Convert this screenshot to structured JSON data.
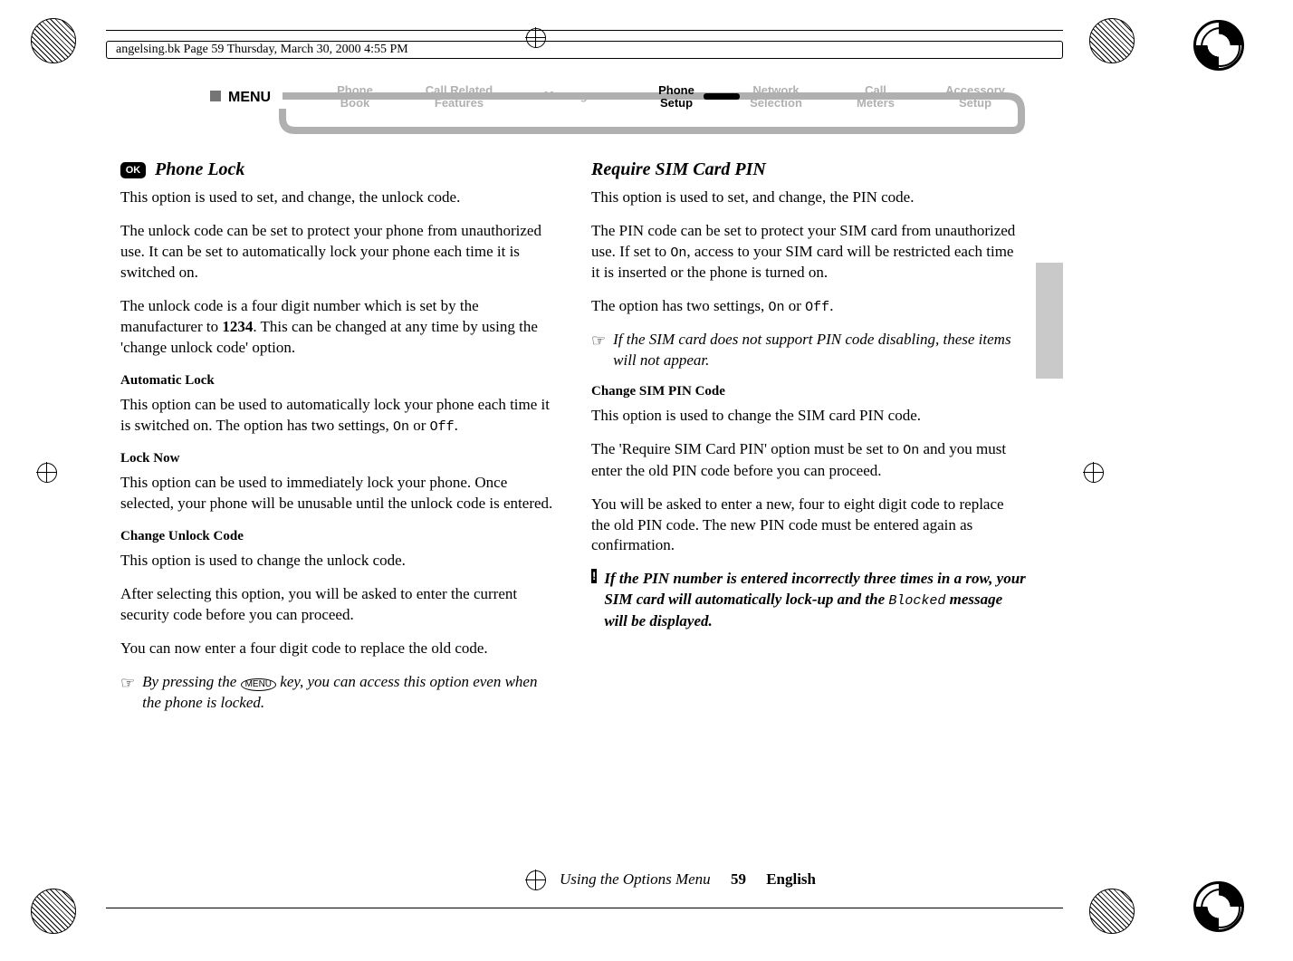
{
  "print_header": "angelsing.bk  Page 59  Thursday, March 30, 2000  4:55 PM",
  "ok_badge": "OK",
  "nav": {
    "menu_label": "MENU",
    "items": [
      {
        "l1": "Phone",
        "l2": "Book",
        "active": false
      },
      {
        "l1": "Call Related",
        "l2": "Features",
        "active": false
      },
      {
        "l1": "Messages",
        "l2": "",
        "active": false
      },
      {
        "l1": "Phone",
        "l2": "Setup",
        "active": true
      },
      {
        "l1": "Network",
        "l2": "Selection",
        "active": false
      },
      {
        "l1": "Call",
        "l2": "Meters",
        "active": false
      },
      {
        "l1": "Accessory",
        "l2": "Setup",
        "active": false
      }
    ]
  },
  "left": {
    "title": "Phone Lock",
    "p1": "This option is used to set, and change, the unlock code.",
    "p2": "The unlock code can be set to protect your phone from unauthorized use. It can be set to automatically lock your phone each time it is switched on.",
    "p3a": "The unlock code is a four digit number which is set by the manufacturer to ",
    "p3code": "1234",
    "p3b": ". This can be changed at any time by using the 'change unlock code' option.",
    "h_auto": "Automatic Lock",
    "p_auto_a": "This option can be used to automatically lock your phone each time it is switched on. The option has two settings, ",
    "mono_on": "On",
    "p_auto_b": " or ",
    "mono_off": "Off",
    "p_auto_c": ".",
    "h_locknow": "Lock Now",
    "p_locknow": "This option can be used to immediately lock your phone. Once selected, your phone will be unusable until the unlock code is entered.",
    "h_change": "Change Unlock Code",
    "p_change1": "This option is used to change the unlock code.",
    "p_change2": "After selecting this option, you will be asked to enter the current security code before you can proceed.",
    "p_change3": "You can now enter a four digit code to replace the old code.",
    "note_a": "By pressing the ",
    "note_key": "MENU",
    "note_b": " key, you can access this option even when the phone is locked."
  },
  "right": {
    "title": "Require SIM Card PIN",
    "p1": "This option is used to set, and change, the PIN code.",
    "p2a": "The PIN code can be set to protect your SIM card from unauthorized use. If set to ",
    "mono_on": "On",
    "p2b": ", access to your SIM card will be restricted each time it is inserted or the phone is turned on.",
    "p3a": "The option has two settings, ",
    "p3b": " or ",
    "mono_off": "Off",
    "p3c": ".",
    "note": "If the SIM card does not support PIN code disabling, these items will not appear.",
    "h_change": "Change SIM PIN Code",
    "p_c1": "This option is used to change the SIM card PIN code.",
    "p_c2a": "The 'Require SIM Card PIN' option must be set to ",
    "p_c2b": " and you must enter the old PIN code before you can proceed.",
    "p_c3": "You will be asked to enter a new, four to eight digit code to replace the old PIN code. The new PIN code must be entered again as confirmation.",
    "warn_a": "If the PIN number is entered incorrectly three times in a row, your SIM card will automatically lock-up and the ",
    "warn_mono": "Blocked",
    "warn_b": " message will be displayed."
  },
  "footer": {
    "section": "Using the Options Menu",
    "page": "59",
    "lang": "English"
  }
}
